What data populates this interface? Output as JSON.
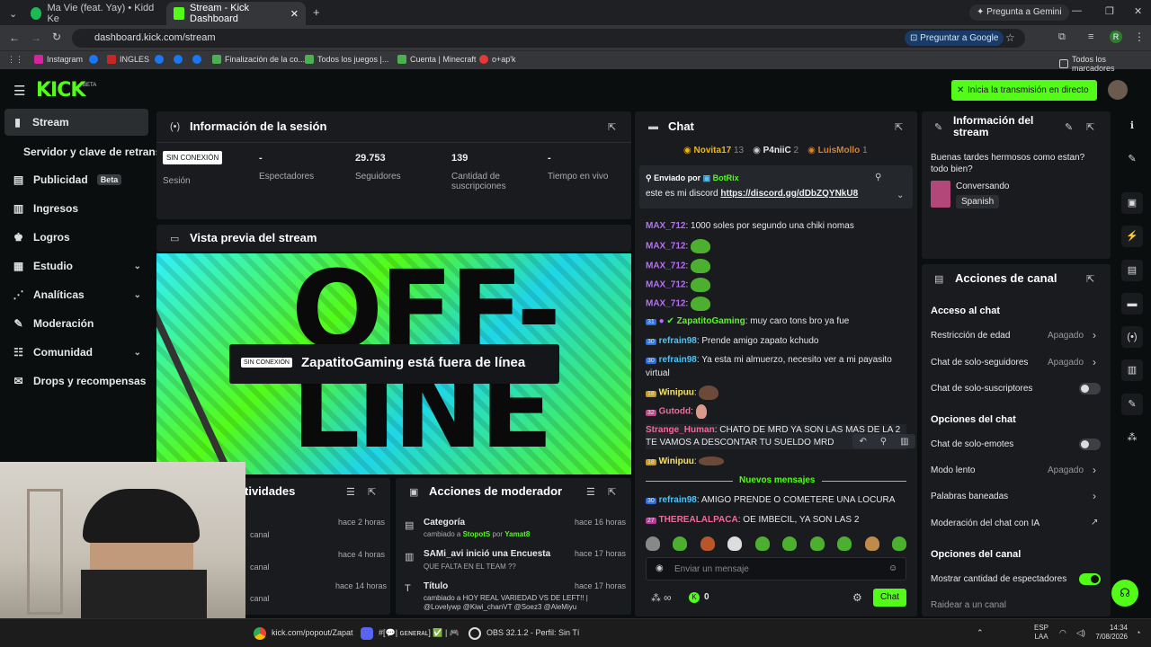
{
  "browser": {
    "tabs": [
      {
        "title": "Ma Vie (feat. Yay) • Kidd Ke"
      },
      {
        "title": "Stream - Kick Dashboard"
      }
    ],
    "gemini": "Pregunta a Gemini",
    "url": "dashboard.kick.com/stream",
    "ask_google": "Preguntar a Google",
    "avatar_letter": "R"
  },
  "bookmarks": [
    "Instagram",
    "INGLES",
    "Finalización de la co...",
    "Todos los juegos |...",
    "Cuenta | Minecraft",
    "o+ap'k"
  ],
  "all_bookmarks": "Todos los marcadores",
  "header": {
    "logo": "KICK",
    "beta": "BETA",
    "go_live": "Inicia la transmisión en directo"
  },
  "sidebar": {
    "items": [
      {
        "label": "Stream"
      },
      {
        "label": "Servidor y clave de retransmi"
      },
      {
        "label": "Publicidad",
        "badge": "Beta"
      },
      {
        "label": "Ingresos"
      },
      {
        "label": "Logros"
      },
      {
        "label": "Estudio"
      },
      {
        "label": "Analíticas"
      },
      {
        "label": "Moderación"
      },
      {
        "label": "Comunidad"
      },
      {
        "label": "Drops y recompensas"
      }
    ]
  },
  "session": {
    "title": "Información de la sesión",
    "status": "SIN CONEXIÓN",
    "status_label": "Sesión",
    "stats": [
      {
        "value": "-",
        "label": "Espectadores"
      },
      {
        "value": "29.753",
        "label": "Seguidores"
      },
      {
        "value": "139",
        "label": "Cantidad de suscripciones"
      },
      {
        "value": "-",
        "label": "Tiempo en vivo"
      }
    ]
  },
  "preview": {
    "title": "Vista previa del stream",
    "badge": "SIN CONEXIÓN",
    "offline_text": "ZapatitoGaming está fuera de línea",
    "bg_text": "OFF-LINE"
  },
  "activities": {
    "title": "tividades",
    "items": [
      {
        "time": "hace 2 horas",
        "text": "canal"
      },
      {
        "time": "hace 4 horas",
        "text": "canal"
      },
      {
        "time": "hace 14 horas",
        "text": "canal"
      }
    ]
  },
  "modactions": {
    "title": "Acciones de moderador",
    "items": [
      {
        "title": "Categoría",
        "time": "hace 16 horas",
        "detail_a": "cambiado a ",
        "detail_b": "StopotS",
        "detail_c": " por ",
        "detail_d": "Yamat8"
      },
      {
        "title": "SAMi_avi inició una Encuesta",
        "time": "hace 17 horas",
        "detail_a": "QUE FALTA EN EL TEAM ??"
      },
      {
        "title": "Título",
        "time": "hace 17 horas",
        "detail_a": "cambiado a HOY REAL VARIEDAD VS DE LEFT!! |",
        "detail_b": "@Lovelywp @Kiwi_chanVT @Soez3 @AleMiyu"
      }
    ]
  },
  "chat": {
    "title": "Chat",
    "gifters": [
      {
        "name": "Novita17",
        "count": "13"
      },
      {
        "name": "P4niiC",
        "count": "2"
      },
      {
        "name": "LuisMollo",
        "count": "1"
      }
    ],
    "pinned": {
      "sent_by": "Enviado por",
      "bot": "BotRix",
      "message": "este es mi discord ",
      "link": "https://discord.gg/dDbZQYNkU8"
    },
    "messages": [
      {
        "user": "MAX_712",
        "text": ": 1000 soles por segundo una chiki nomas",
        "color": "#b86ef7"
      },
      {
        "user": "MAX_712",
        "text": ":",
        "color": "#b86ef7",
        "emote": true
      },
      {
        "user": "MAX_712",
        "text": ":",
        "color": "#b86ef7",
        "emote": true
      },
      {
        "user": "MAX_712",
        "text": ":",
        "color": "#b86ef7",
        "emote": true
      },
      {
        "user": "MAX_712",
        "text": ":",
        "color": "#b86ef7",
        "emote": true
      },
      {
        "user": "ZapatitoGaming",
        "text": ": muy caro tons bro ya fue",
        "color": "#53fc18",
        "badge": "31"
      },
      {
        "user": "refrain98",
        "text": ": Prende amigo zapato kchudo",
        "color": "#4fc3f7",
        "badge": "30"
      },
      {
        "user": "refrain98",
        "text": ": Ya esta mi almuerzo, necesito ver a mi payasito virtual",
        "color": "#4fc3f7",
        "badge": "30"
      },
      {
        "user": "Winipuu",
        "text": ":",
        "color": "#f7e36e",
        "badge": "18"
      },
      {
        "user": "Gutodd",
        "text": ":",
        "color": "#f06a9b",
        "badge": "32"
      },
      {
        "user": "Strange_Human",
        "text": ": CHATO DE MRD YA SON LAS MAS DE LA 2 TE VAMOS A DESCONTAR TU SUELDO MRD",
        "color": "#f06a9b"
      },
      {
        "user": "Winipuu",
        "text": ":",
        "color": "#f7e36e",
        "badge": "18"
      }
    ],
    "new_messages": "Nuevos mensajes",
    "newer": [
      {
        "user": "refrain98",
        "text": ": AMIGO PRENDE O COMETERE UNA LOCURA",
        "color": "#4fc3f7",
        "badge": "30"
      },
      {
        "user": "THEREALALPACA",
        "text": ": OE IMBECIL, YA SON LAS 2",
        "color": "#f06a9b",
        "badge": "27"
      }
    ],
    "input_placeholder": "Enviar un mensaje",
    "infinity": "∞",
    "points": "0",
    "send": "Chat"
  },
  "streaminfo": {
    "title": "Información del stream",
    "message": "Buenas tardes hermosos como estan? todo bien?",
    "category": "Conversando",
    "language": "Spanish"
  },
  "channelactions": {
    "title": "Acciones de canal",
    "chat_access": "Acceso al chat",
    "rows1": [
      {
        "label": "Restricción de edad",
        "value": "Apagado"
      },
      {
        "label": "Chat de solo-seguidores",
        "value": "Apagado"
      },
      {
        "label": "Chat de solo-suscriptores",
        "value": ""
      }
    ],
    "chat_options": "Opciones del chat",
    "rows2": [
      {
        "label": "Chat de solo-emotes",
        "value": ""
      },
      {
        "label": "Modo lento",
        "value": "Apagado"
      },
      {
        "label": "Palabras baneadas",
        "value": ""
      },
      {
        "label": "Moderación del chat con IA",
        "value": ""
      }
    ],
    "channel_options": "Opciones del canal",
    "show_viewers": "Mostrar cantidad de espectadores",
    "raid": "Raidear a un canal"
  },
  "taskbar": {
    "items": [
      "kick.com/popout/Zapat",
      "#[💬| ɢᴇɴᴇʀᴀʟ] ✅ | 🎮 Z",
      "OBS 32.1.2 - Perfil: Sin Tí"
    ],
    "lang": "ESP",
    "lang2": "LAA",
    "time": "14:34",
    "date": "7/08/2026"
  },
  "colors": {
    "kick_green": "#53fc18",
    "panel": "#191b1f",
    "bg": "#0b0e0f"
  }
}
